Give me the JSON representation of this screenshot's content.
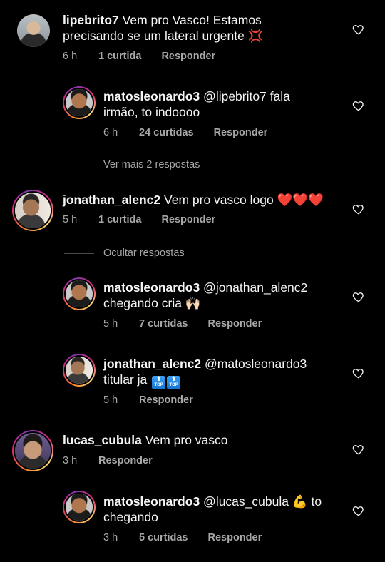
{
  "comments": [
    {
      "username": "lipebrito7",
      "text_line1": " Vem pro Vasco! Estamos",
      "text_line2": "precisando se um lateral urgente ",
      "emoji": "💢",
      "time": "6 h",
      "likes": "1 curtida",
      "reply": "Responder"
    },
    {
      "username": "matosleonardo3",
      "text_line1": " @lipebrito7 fala",
      "text_line2": "irmão, to indoooo",
      "time": "6 h",
      "likes": "24 curtidas",
      "reply": "Responder"
    },
    {
      "more_replies": "Ver mais 2 respostas"
    },
    {
      "username": "jonathan_alenc2",
      "text_line1": " Vem pro vasco logo ",
      "emoji": "❤️❤️❤️",
      "time": "5 h",
      "likes": "1 curtida",
      "reply": "Responder"
    },
    {
      "hide_replies": "Ocultar respostas"
    },
    {
      "username": "matosleonardo3",
      "text_line1": " @jonathan_alenc2",
      "text_line2": "chegando cria ",
      "emoji": "🙌🏻",
      "time": "5 h",
      "likes": "7 curtidas",
      "reply": "Responder"
    },
    {
      "username": "jonathan_alenc2",
      "text_line1": " @matosleonardo3",
      "text_line2": "titular ja ",
      "badge": "TOP",
      "time": "5 h",
      "reply": "Responder"
    },
    {
      "username": "lucas_cubula",
      "text_line1": " Vem pro vasco",
      "time": "3 h",
      "reply": "Responder"
    },
    {
      "username": "matosleonardo3",
      "text_line1": " @lucas_cubula ",
      "emoji": "💪",
      "text_line1b": " to",
      "text_line2": "chegando",
      "time": "3 h",
      "likes": "5 curtidas",
      "reply": "Responder"
    }
  ],
  "colors": {
    "background": "#000000",
    "text": "#f5f5f5",
    "secondary": "#a8a8a8",
    "story_ring": "#dd2a7b"
  },
  "icons": {
    "like": "heart-outline-icon"
  }
}
